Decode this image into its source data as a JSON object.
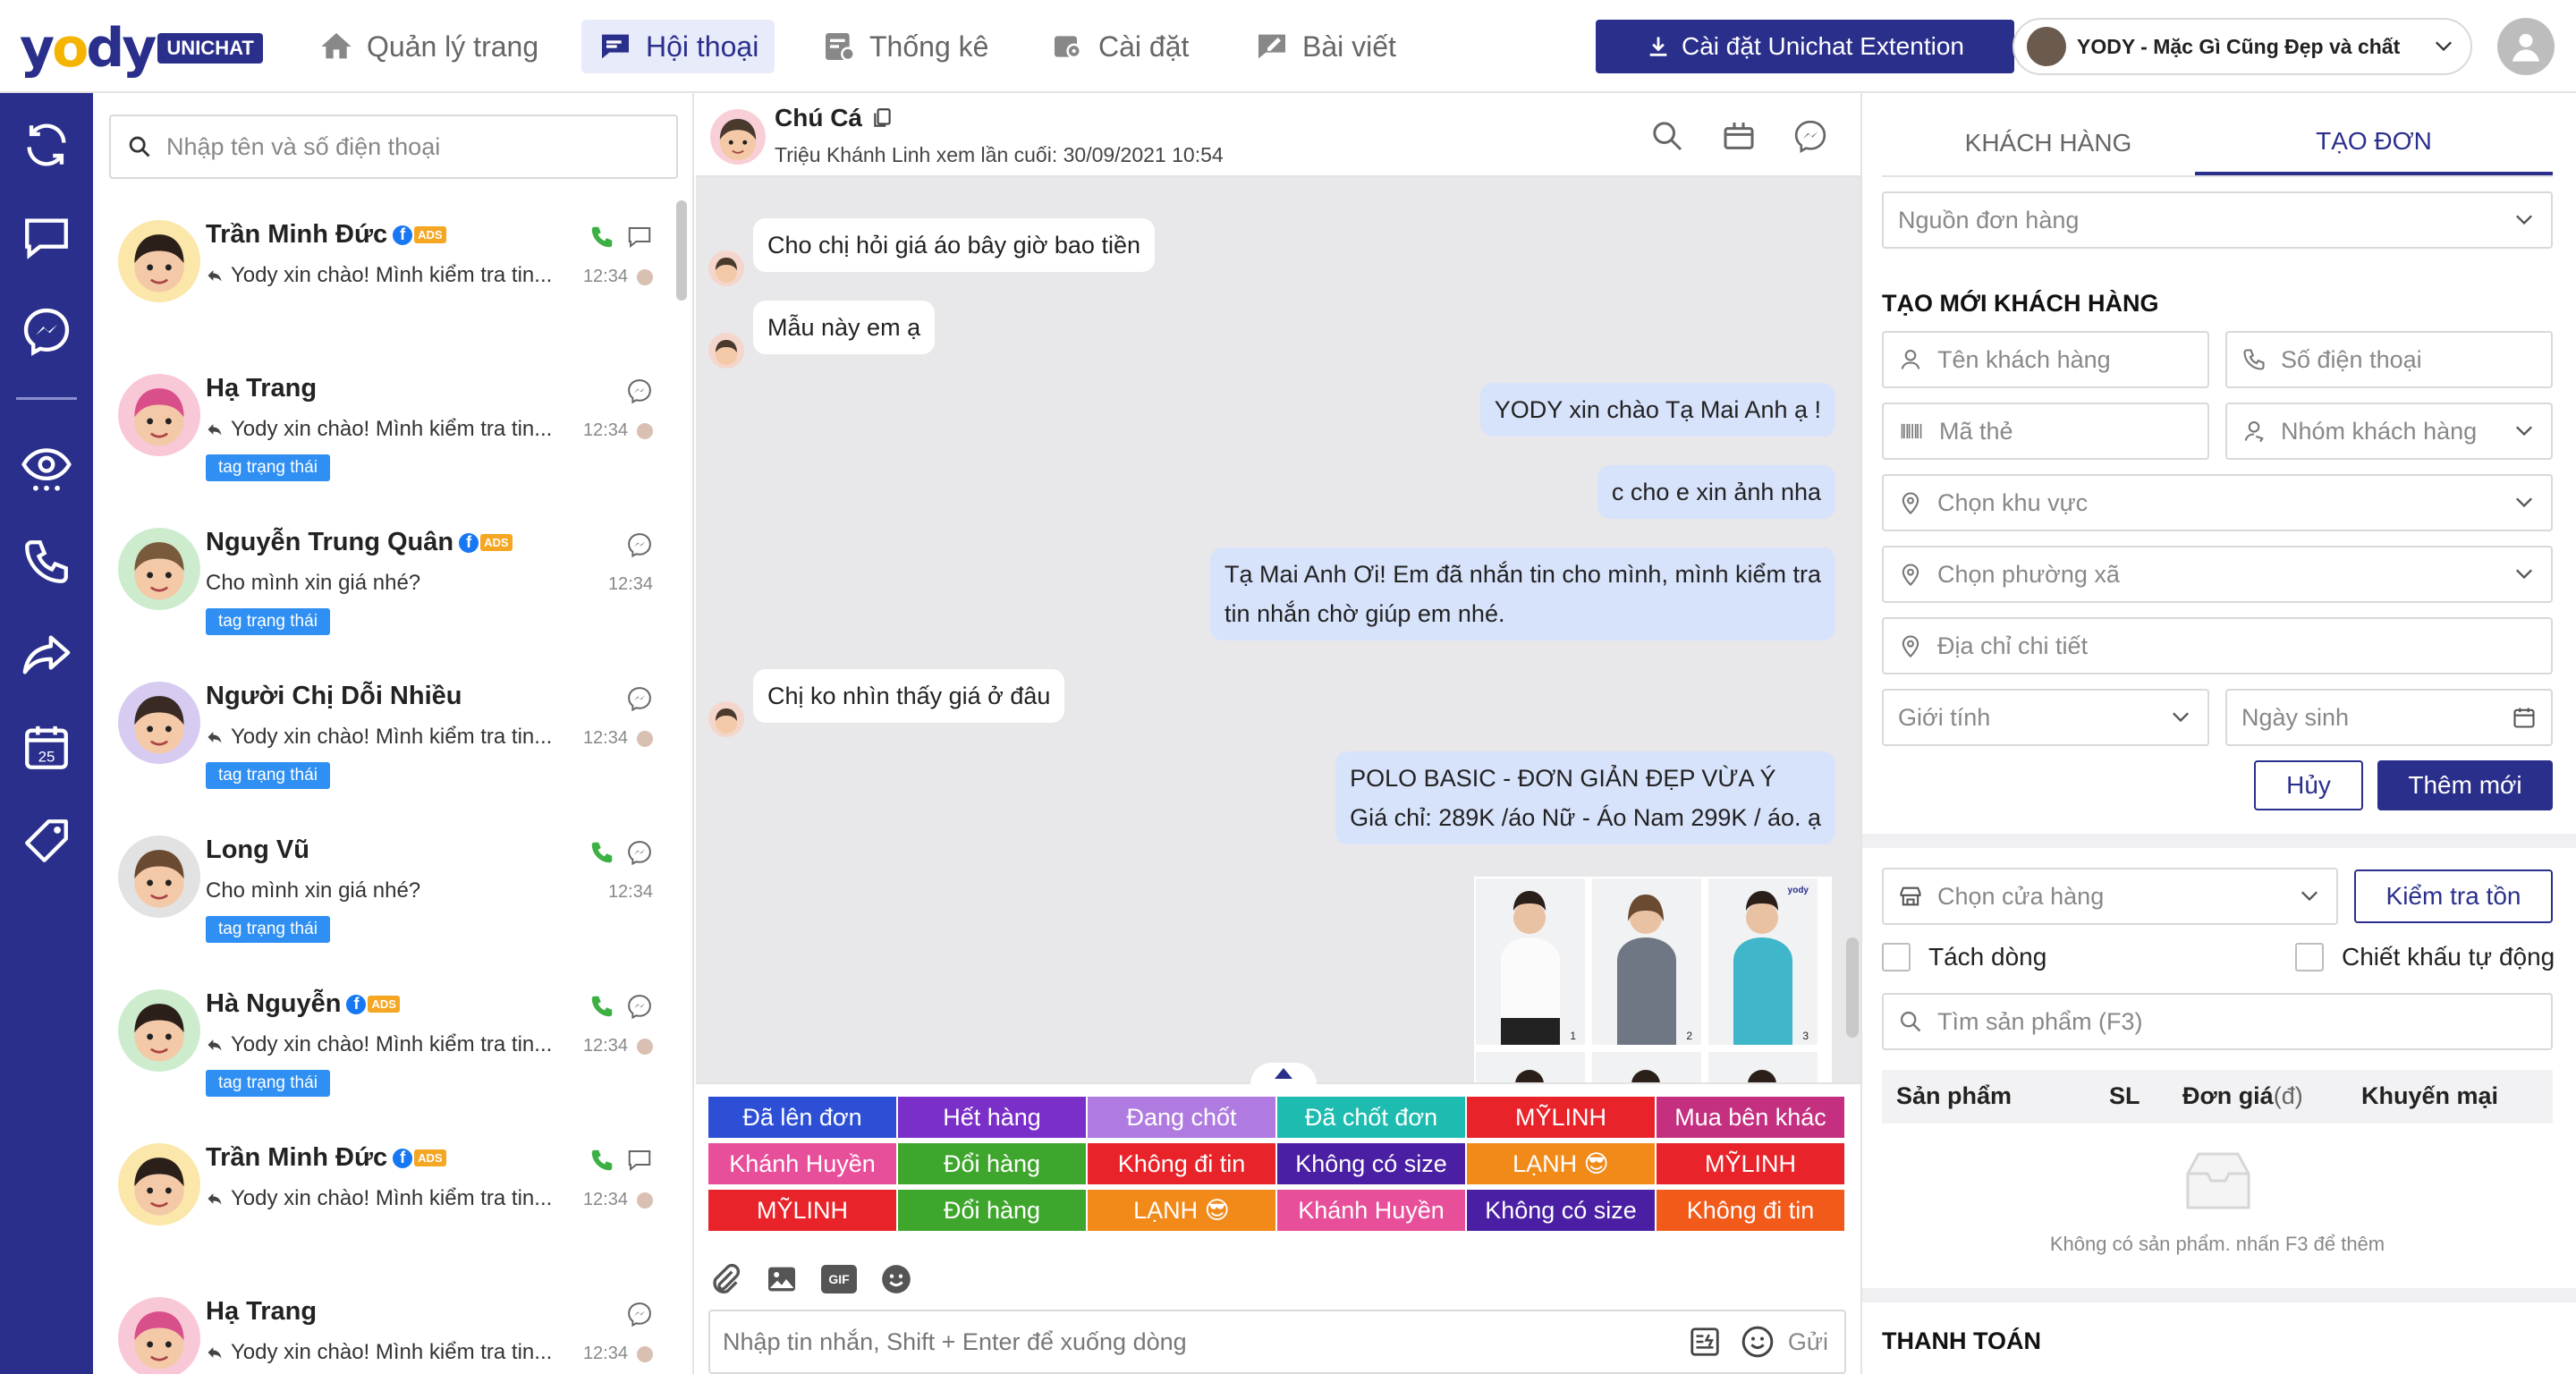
{
  "app": {
    "logo_text": "yody",
    "logo_badge": "UNICHAT",
    "nav": [
      {
        "label": "Quản lý trang"
      },
      {
        "label": "Hội thoại"
      },
      {
        "label": "Thống kê"
      },
      {
        "label": "Cài đặt"
      },
      {
        "label": "Bài viết"
      }
    ],
    "install_button": "Cài đặt Unichat Extention",
    "page_selector": "YODY - Mặc Gì Cũng Đẹp và chất",
    "rail_calendar_day": "25"
  },
  "colors": {
    "brand": "#2a2f8c",
    "accent_yellow": "#f5b400",
    "tag_blue": "#2f8ff2",
    "out_bubble": "#d7e2fb",
    "call_green": "#3cb043"
  },
  "conversation_list": {
    "search_placeholder": "Nhập tên và số điện thoại",
    "items": [
      {
        "name": "Trần Minh Đức",
        "ads": true,
        "preview": "Yody xin chào! Mình kiểm tra tin...",
        "replied": true,
        "time": "12:34",
        "tag": "",
        "call": true,
        "channel": "comment-icon"
      },
      {
        "name": "Hạ Trang",
        "ads": false,
        "preview": "Yody xin chào! Mình kiểm tra tin...",
        "replied": true,
        "time": "12:34",
        "tag": "tag trạng thái",
        "call": false,
        "channel": "messenger-icon"
      },
      {
        "name": "Nguyễn Trung Quân",
        "ads": true,
        "preview": "Cho mình xin giá nhé?",
        "replied": false,
        "time": "12:34",
        "tag": "tag trạng thái",
        "call": false,
        "channel": "messenger-icon"
      },
      {
        "name": "Người Chị Dỗi Nhiều",
        "ads": false,
        "preview": "Yody xin chào! Mình kiểm tra tin...",
        "replied": true,
        "time": "12:34",
        "tag": "tag trạng thái",
        "call": false,
        "channel": "messenger-icon"
      },
      {
        "name": "Long Vũ",
        "ads": false,
        "preview": "Cho mình xin giá nhé?",
        "replied": false,
        "time": "12:34",
        "tag": "tag trạng thái",
        "call": true,
        "channel": "messenger-icon"
      },
      {
        "name": "Hà Nguyễn",
        "ads": true,
        "preview": "Yody xin chào! Mình kiểm tra tin...",
        "replied": true,
        "time": "12:34",
        "tag": "tag trạng thái",
        "call": true,
        "channel": "messenger-icon"
      },
      {
        "name": "Trần Minh Đức",
        "ads": true,
        "preview": "Yody xin chào! Mình kiểm tra tin...",
        "replied": true,
        "time": "12:34",
        "tag": "",
        "call": true,
        "channel": "comment-icon"
      },
      {
        "name": "Hạ Trang",
        "ads": false,
        "preview": "Yody xin chào! Mình kiểm tra tin...",
        "replied": true,
        "time": "12:34",
        "tag": "tag trạng thái",
        "call": false,
        "channel": "messenger-icon"
      }
    ]
  },
  "chat": {
    "contact_name": "Chú Cá",
    "last_seen": "Triệu Khánh Linh xem lần cuối: 30/09/2021 10:54",
    "messages": [
      {
        "dir": "in",
        "text": "Cho chị hỏi giá áo bây giờ bao tiền"
      },
      {
        "dir": "in",
        "text": "Mẫu này em ạ"
      },
      {
        "dir": "out",
        "text": "YODY xin chào Tạ Mai Anh ạ !"
      },
      {
        "dir": "out",
        "text": "c cho e xin ảnh nha"
      },
      {
        "dir": "out",
        "lines": [
          "Tạ Mai Anh Ơi! Em đã nhắn tin cho mình, mình kiểm tra",
          "tin nhắn chờ giúp em nhé."
        ]
      },
      {
        "dir": "in",
        "text": "Chị ko nhìn thấy giá ở đâu"
      },
      {
        "dir": "out",
        "lines": [
          "POLO BASIC - ĐƠN GIẢN ĐẸP VỪA Ý",
          "Giá chỉ: 289K /áo Nữ - Áo Nam 299K / áo. ạ"
        ]
      }
    ],
    "product_images": [
      "1",
      "2",
      "3"
    ],
    "product_brand_mark": "yody",
    "quick_tags": [
      {
        "label": "Đã lên đơn",
        "color": "#2d4fd6"
      },
      {
        "label": "Hết hàng",
        "color": "#7b2fc9"
      },
      {
        "label": "Đang chốt",
        "color": "#b07be0"
      },
      {
        "label": "Đã chốt đơn",
        "color": "#1ebcb0"
      },
      {
        "label": "MỸLINH",
        "color": "#e8232a"
      },
      {
        "label": "Mua bên khác",
        "color": "#c4307f"
      },
      {
        "label": "Khánh Huyền",
        "color": "#e84f9a"
      },
      {
        "label": "Đổi hàng",
        "color": "#3fa62d"
      },
      {
        "label": "Không đi tin",
        "color": "#e8232a"
      },
      {
        "label": "Không có size",
        "color": "#4a1fa3"
      },
      {
        "label": "LẠNH 😎",
        "color": "#f28a1a"
      },
      {
        "label": "MỸLINH",
        "color": "#e8232a"
      },
      {
        "label": "MỸLINH",
        "color": "#e8232a"
      },
      {
        "label": "Đổi hàng",
        "color": "#3fa62d"
      },
      {
        "label": "LẠNH 😎",
        "color": "#f28a1a"
      },
      {
        "label": "Khánh Huyền",
        "color": "#e84f9a"
      },
      {
        "label": "Không có size",
        "color": "#4a1fa3"
      },
      {
        "label": "Không đi tin",
        "color": "#f25a1a"
      }
    ],
    "composer_placeholder": "Nhập tin nhắn, Shift + Enter để xuống dòng",
    "send_label": "Gửi",
    "gif_label": "GIF"
  },
  "order_panel": {
    "tabs": [
      "KHÁCH HÀNG",
      "TẠO ĐƠN"
    ],
    "active_tab": "TẠO ĐƠN",
    "order_source": "Nguồn đơn hàng",
    "new_customer_title": "TẠO MỚI KHÁCH HÀNG",
    "customer_name": "Tên khách hàng",
    "phone": "Số điện thoại",
    "card_code": "Mã thẻ",
    "customer_group": "Nhóm khách hàng",
    "region": "Chọn khu vực",
    "ward": "Chọn phường xã",
    "address": "Địa chỉ chi tiết",
    "gender": "Giới tính",
    "birthday": "Ngày sinh",
    "cancel_button": "Hủy",
    "add_button": "Thêm mới",
    "store_select": "Chọn cửa hàng",
    "check_stock_button": "Kiểm tra tồn",
    "split_line": "Tách dòng",
    "auto_discount": "Chiết khấu tự động",
    "product_search": "Tìm sản phẩm (F3)",
    "columns": {
      "product": "Sản phẩm",
      "qty": "SL",
      "price": "Đơn giá",
      "price_unit": "(đ)",
      "promo": "Khuyến mại"
    },
    "empty_text": "Không có sản phẩm. nhấn F3 để thêm",
    "payment_title": "THANH TOÁN"
  }
}
